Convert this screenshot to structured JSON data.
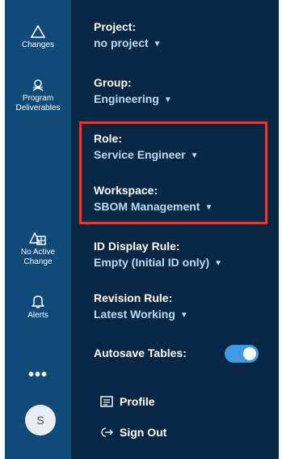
{
  "rail": {
    "items": [
      {
        "label1": "Changes",
        "label2": ""
      },
      {
        "label1": "Program",
        "label2": "Deliverables"
      },
      {
        "label1": "No Active",
        "label2": "Change"
      },
      {
        "label1": "Alerts",
        "label2": ""
      }
    ],
    "more": "•••",
    "avatar_initial": "S"
  },
  "panel": {
    "project": {
      "label": "Project:",
      "value": "no project"
    },
    "group": {
      "label": "Group:",
      "value": "Engineering"
    },
    "role": {
      "label": "Role:",
      "value": "Service Engineer"
    },
    "workspace": {
      "label": "Workspace:",
      "value": "SBOM Management"
    },
    "id_display_rule": {
      "label": "ID Display Rule:",
      "value": "Empty (Initial ID only)"
    },
    "revision_rule": {
      "label": "Revision Rule:",
      "value": "Latest Working"
    },
    "autosave": {
      "label": "Autosave Tables:",
      "enabled": true
    },
    "profile_label": "Profile",
    "signout_label": "Sign Out"
  },
  "colors": {
    "rail_bg": "#0f4a78",
    "panel_bg": "#082744",
    "value_text": "#b9dcf6",
    "highlight_border": "#e0393e",
    "toggle_on": "#3f9ae3"
  }
}
